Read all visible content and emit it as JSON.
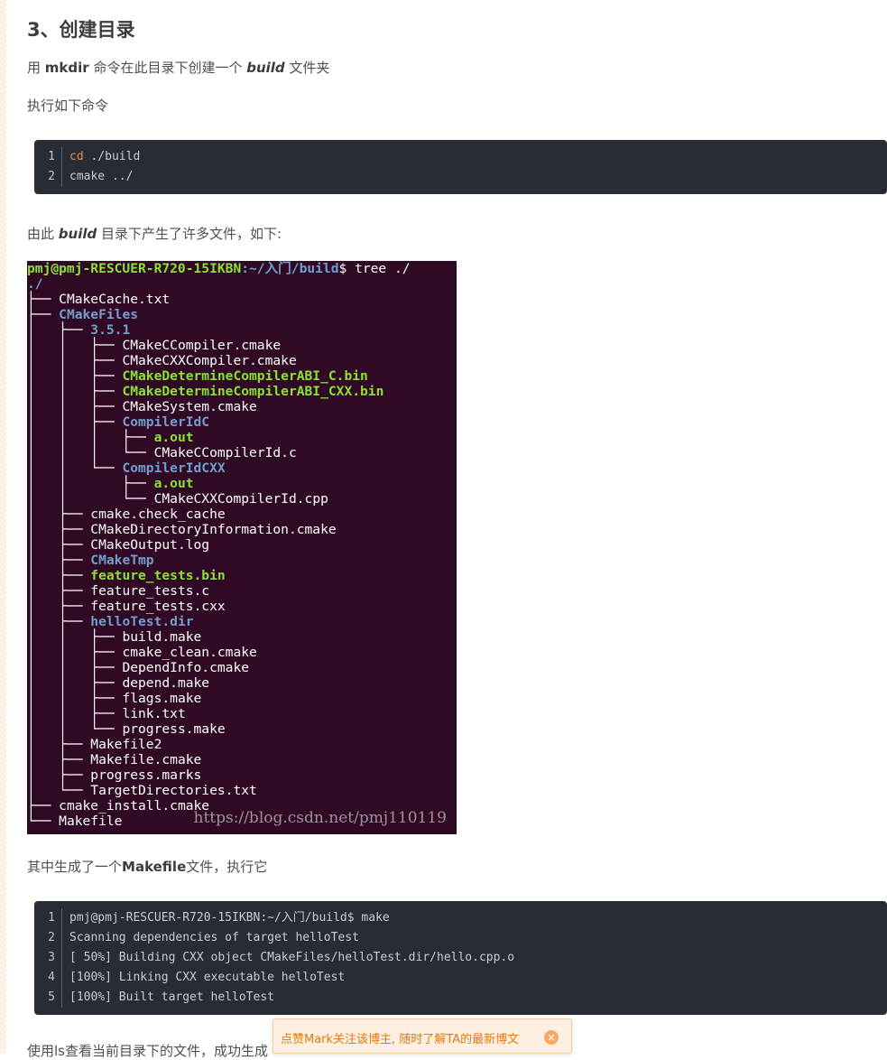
{
  "heading": "3、创建目录",
  "para1": {
    "pre": "用 ",
    "cmd": "mkdir",
    "mid": " 命令在此目录下创建一个 ",
    "dir": "build",
    "post": " 文件夹"
  },
  "para2": "执行如下命令",
  "code1": {
    "lines": [
      {
        "num": "1",
        "kw": "cd",
        "rest": " ./build"
      },
      {
        "num": "2",
        "kw": "",
        "rest": "cmake ../"
      }
    ]
  },
  "para3": {
    "pre": "由此 ",
    "dir": "build",
    "post": " 目录下产生了许多文件，如下:"
  },
  "terminal": {
    "prompt_user": "pmj@pmj-RESCUER-R720-15IKBN",
    "prompt_path": ":~/入门/build",
    "prompt_cmd": "$ tree ./",
    "root": "./",
    "lines": [
      {
        "prefix": "├── ",
        "name": "CMakeCache.txt",
        "type": "file"
      },
      {
        "prefix": "├── ",
        "name": "CMakeFiles",
        "type": "dir"
      },
      {
        "prefix": "│   ├── ",
        "name": "3.5.1",
        "type": "dir"
      },
      {
        "prefix": "│   │   ├── ",
        "name": "CMakeCCompiler.cmake",
        "type": "file"
      },
      {
        "prefix": "│   │   ├── ",
        "name": "CMakeCXXCompiler.cmake",
        "type": "file"
      },
      {
        "prefix": "│   │   ├── ",
        "name": "CMakeDetermineCompilerABI_C.bin",
        "type": "exec"
      },
      {
        "prefix": "│   │   ├── ",
        "name": "CMakeDetermineCompilerABI_CXX.bin",
        "type": "exec"
      },
      {
        "prefix": "│   │   ├── ",
        "name": "CMakeSystem.cmake",
        "type": "file"
      },
      {
        "prefix": "│   │   ├── ",
        "name": "CompilerIdC",
        "type": "dir"
      },
      {
        "prefix": "│   │   │   ├── ",
        "name": "a.out",
        "type": "exec"
      },
      {
        "prefix": "│   │   │   └── ",
        "name": "CMakeCCompilerId.c",
        "type": "file"
      },
      {
        "prefix": "│   │   └── ",
        "name": "CompilerIdCXX",
        "type": "dir"
      },
      {
        "prefix": "│   │       ├── ",
        "name": "a.out",
        "type": "exec"
      },
      {
        "prefix": "│   │       └── ",
        "name": "CMakeCXXCompilerId.cpp",
        "type": "file"
      },
      {
        "prefix": "│   ├── ",
        "name": "cmake.check_cache",
        "type": "file"
      },
      {
        "prefix": "│   ├── ",
        "name": "CMakeDirectoryInformation.cmake",
        "type": "file"
      },
      {
        "prefix": "│   ├── ",
        "name": "CMakeOutput.log",
        "type": "file"
      },
      {
        "prefix": "│   ├── ",
        "name": "CMakeTmp",
        "type": "dir"
      },
      {
        "prefix": "│   ├── ",
        "name": "feature_tests.bin",
        "type": "exec"
      },
      {
        "prefix": "│   ├── ",
        "name": "feature_tests.c",
        "type": "file"
      },
      {
        "prefix": "│   ├── ",
        "name": "feature_tests.cxx",
        "type": "file"
      },
      {
        "prefix": "│   ├── ",
        "name": "helloTest.dir",
        "type": "dir"
      },
      {
        "prefix": "│   │   ├── ",
        "name": "build.make",
        "type": "file"
      },
      {
        "prefix": "│   │   ├── ",
        "name": "cmake_clean.cmake",
        "type": "file"
      },
      {
        "prefix": "│   │   ├── ",
        "name": "DependInfo.cmake",
        "type": "file"
      },
      {
        "prefix": "│   │   ├── ",
        "name": "depend.make",
        "type": "file"
      },
      {
        "prefix": "│   │   ├── ",
        "name": "flags.make",
        "type": "file"
      },
      {
        "prefix": "│   │   ├── ",
        "name": "link.txt",
        "type": "file"
      },
      {
        "prefix": "│   │   └── ",
        "name": "progress.make",
        "type": "file"
      },
      {
        "prefix": "│   ├── ",
        "name": "Makefile2",
        "type": "file"
      },
      {
        "prefix": "│   ├── ",
        "name": "Makefile.cmake",
        "type": "file"
      },
      {
        "prefix": "│   ├── ",
        "name": "progress.marks",
        "type": "file"
      },
      {
        "prefix": "│   └── ",
        "name": "TargetDirectories.txt",
        "type": "file"
      },
      {
        "prefix": "├── ",
        "name": "cmake_install.cmake",
        "type": "file"
      },
      {
        "prefix": "└── ",
        "name": "Makefile",
        "type": "file"
      }
    ],
    "watermark": "https://blog.csdn.net/pmj110119"
  },
  "para4": {
    "pre": "其中生成了一个",
    "file": "Makefile",
    "post": "文件，执行它"
  },
  "code2": {
    "lines": [
      {
        "num": "1",
        "text": "pmj@pmj-RESCUER-R720-15IKBN:~/入门/build$ make"
      },
      {
        "num": "2",
        "text": "Scanning dependencies of target helloTest"
      },
      {
        "num": "3",
        "text": "[ 50%] Building CXX object CMakeFiles/helloTest.dir/hello.cpp.o"
      },
      {
        "num": "4",
        "text": "[100%] Linking CXX executable helloTest"
      },
      {
        "num": "5",
        "text": "[100%] Built target helloTest"
      }
    ]
  },
  "toast": {
    "text": "点赞Mark关注该博主, 随时了解TA的最新博文",
    "close": "×"
  },
  "cut_text": "使用ls查看当前目录下的文件，成功生成"
}
